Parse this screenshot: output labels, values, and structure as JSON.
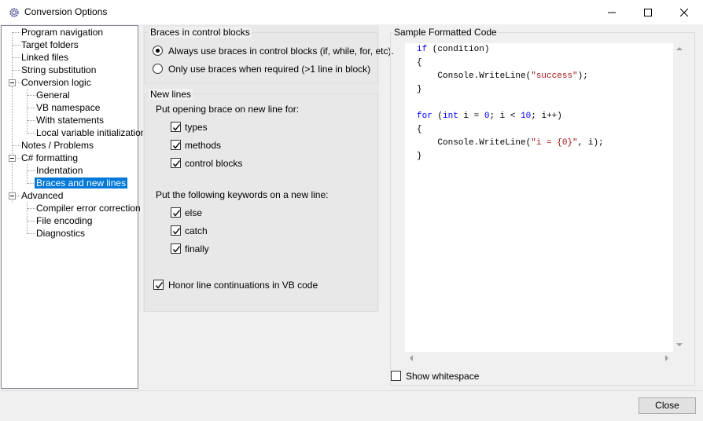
{
  "window": {
    "title": "Conversion Options"
  },
  "tree": [
    {
      "label": "Program navigation",
      "level": 0
    },
    {
      "label": "Target folders",
      "level": 0
    },
    {
      "label": "Linked files",
      "level": 0
    },
    {
      "label": "String substitution",
      "level": 0
    },
    {
      "label": "Conversion logic",
      "level": 0,
      "expanded": true
    },
    {
      "label": "General",
      "level": 1
    },
    {
      "label": "VB namespace",
      "level": 1
    },
    {
      "label": "With statements",
      "level": 1
    },
    {
      "label": "Local variable initialization",
      "level": 1
    },
    {
      "label": "Notes / Problems",
      "level": 0
    },
    {
      "label": "C# formatting",
      "level": 0,
      "expanded": true
    },
    {
      "label": "Indentation",
      "level": 1
    },
    {
      "label": "Braces and new lines",
      "level": 1,
      "selected": true
    },
    {
      "label": "Advanced",
      "level": 0,
      "expanded": true
    },
    {
      "label": "Compiler error correction",
      "level": 1
    },
    {
      "label": "File encoding",
      "level": 1
    },
    {
      "label": "Diagnostics",
      "level": 1
    }
  ],
  "braces": {
    "title": "Braces in control blocks",
    "option_always": "Always use braces in control blocks (if, while, for, etc).",
    "option_required": "Only use braces when required (>1 line in block)",
    "selected": "always"
  },
  "new_lines": {
    "title": "New lines",
    "opening_brace_heading": "Put opening brace on new line for:",
    "types": "types",
    "methods": "methods",
    "control_blocks": "control blocks",
    "keywords_heading": "Put the following keywords on a new line:",
    "else": "else",
    "catch": "catch",
    "finally": "finally",
    "honor_vb": "Honor line continuations in VB code"
  },
  "sample": {
    "title": "Sample Formatted Code",
    "show_whitespace": "Show whitespace"
  },
  "close_label": "Close",
  "colors": {
    "keyword": "#0000ff",
    "string": "#a31515",
    "selection": "#0078d7"
  }
}
